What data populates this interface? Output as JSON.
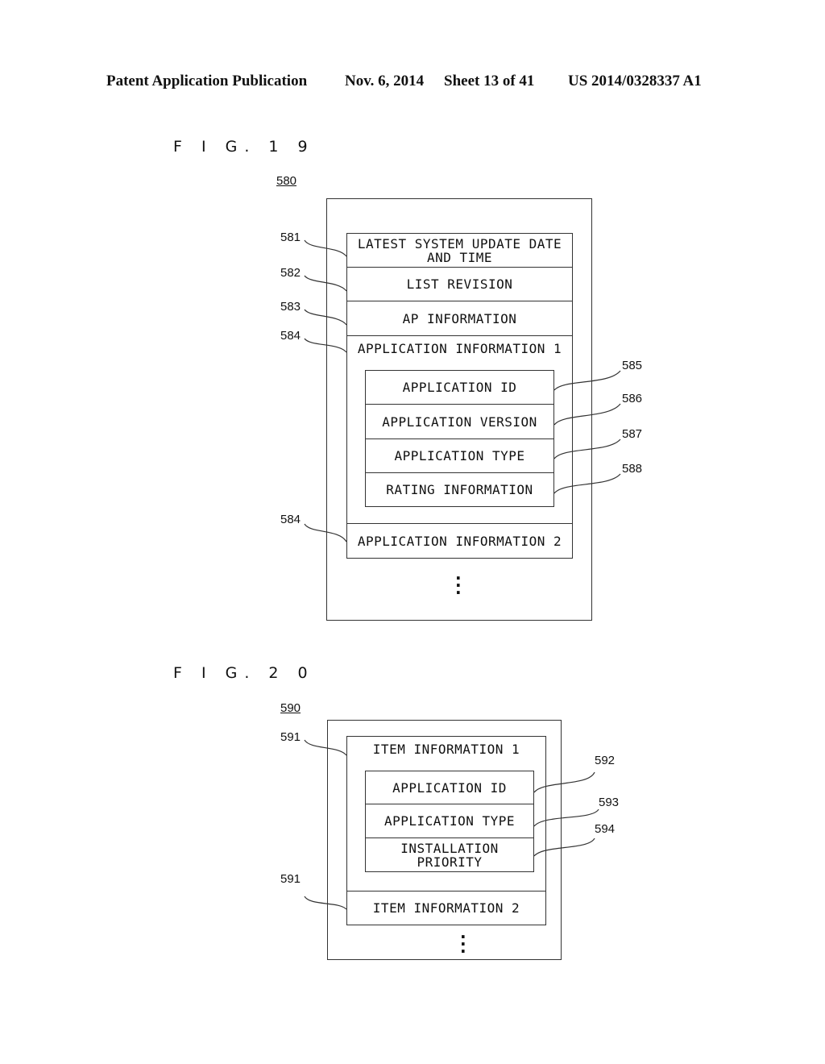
{
  "header": {
    "publication": "Patent Application Publication",
    "date": "Nov. 6, 2014",
    "sheet": "Sheet 13 of 41",
    "number": "US 2014/0328337 A1"
  },
  "fig19": {
    "title": "F I G. 1 9",
    "ref": "580",
    "rows": [
      {
        "ref": "581",
        "label_line1": "LATEST SYSTEM UPDATE DATE",
        "label_line2": "AND TIME"
      },
      {
        "ref": "582",
        "label": "LIST REVISION"
      },
      {
        "ref": "583",
        "label": "AP INFORMATION"
      }
    ],
    "app_info_1": {
      "ref": "584",
      "label": "APPLICATION INFORMATION 1",
      "fields": [
        {
          "ref": "585",
          "label": "APPLICATION ID"
        },
        {
          "ref": "586",
          "label": "APPLICATION VERSION"
        },
        {
          "ref": "587",
          "label": "APPLICATION TYPE"
        },
        {
          "ref": "588",
          "label": "RATING INFORMATION"
        }
      ]
    },
    "app_info_2": {
      "ref": "584",
      "label": "APPLICATION INFORMATION 2"
    },
    "ellipsis": "⋮"
  },
  "fig20": {
    "title": "F I G. 2 0",
    "ref": "590",
    "item_info_1": {
      "ref": "591",
      "label": "ITEM INFORMATION 1",
      "fields": [
        {
          "ref": "592",
          "label": "APPLICATION ID"
        },
        {
          "ref": "593",
          "label": "APPLICATION TYPE"
        },
        {
          "ref": "594",
          "label_line1": "INSTALLATION",
          "label_line2": "PRIORITY"
        }
      ]
    },
    "item_info_2": {
      "ref": "591",
      "label": "ITEM INFORMATION 2"
    },
    "ellipsis": "⋮"
  }
}
